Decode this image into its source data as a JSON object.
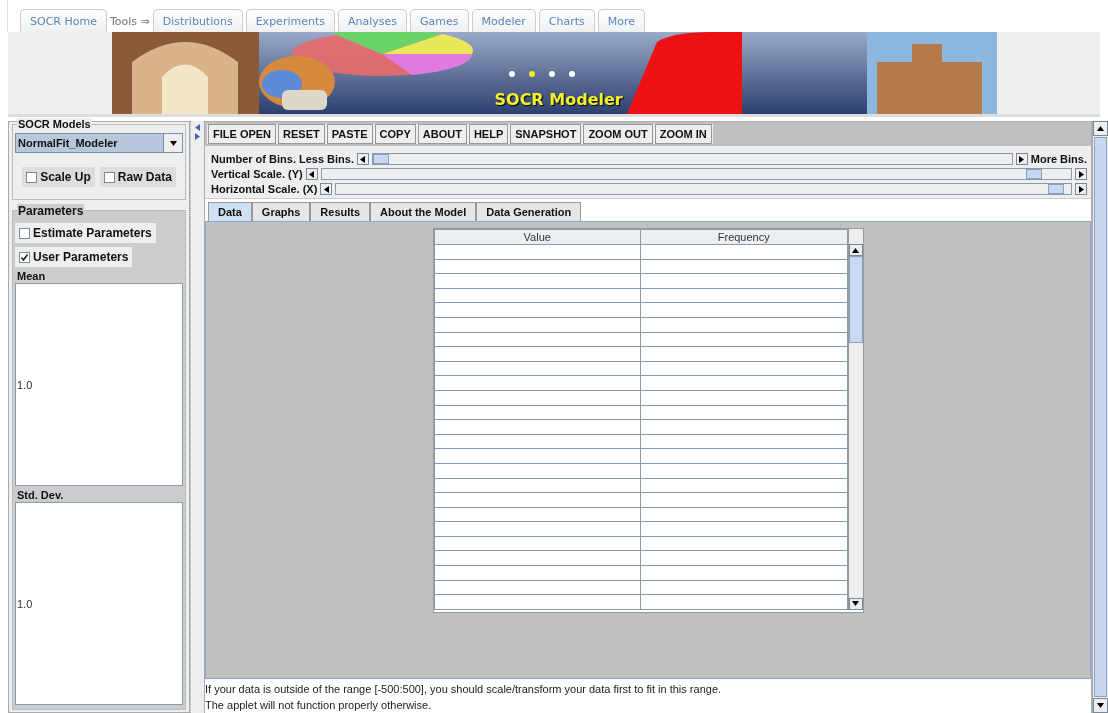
{
  "nav": {
    "home": "SOCR Home",
    "tools_label": "Tools ⇒",
    "tabs": [
      "Distributions",
      "Experiments",
      "Analyses",
      "Games",
      "Modeler",
      "Charts",
      "More"
    ]
  },
  "banner": {
    "title": "SOCR Modeler"
  },
  "models_panel": {
    "title": "SOCR Models",
    "model": "NormalFit_Modeler",
    "options": [
      {
        "label": "Scale Up",
        "checked": false
      },
      {
        "label": "Raw Data",
        "checked": false
      }
    ]
  },
  "parameters": {
    "title": "Parameters",
    "modes": [
      {
        "label": "Estimate Parameters",
        "checked": false
      },
      {
        "label": "User Parameters",
        "checked": true
      }
    ],
    "fields": [
      {
        "label": "Mean",
        "value": "1.0"
      },
      {
        "label": "Std. Dev.",
        "value": "1.0"
      }
    ]
  },
  "toolbar": [
    "FILE OPEN",
    "RESET",
    "PASTE",
    "COPY",
    "ABOUT",
    "HELP",
    "SNAPSHOT",
    "ZOOM OUT",
    "ZOOM IN"
  ],
  "sliders": [
    {
      "label": "Number of Bins.",
      "min_label": "Less Bins.",
      "max_label": "More Bins.",
      "level": 0
    },
    {
      "label": "Vertical Scale. (Y)",
      "level": 0.96
    },
    {
      "label": "Horizontal Scale. (X)",
      "level": 0.99
    }
  ],
  "tabs": [
    {
      "label": "Data",
      "selected": true
    },
    {
      "label": "Graphs",
      "selected": false
    },
    {
      "label": "Results",
      "selected": false
    },
    {
      "label": "About the Model",
      "selected": false
    },
    {
      "label": "Data Generation",
      "selected": false
    }
  ],
  "table": {
    "columns": [
      "Value",
      "Frequency"
    ]
  },
  "message": [
    "If your data is outside of the range [-500:500], you should scale/transform your data first to fit in this range.",
    "The applet will not function properly otherwise."
  ]
}
